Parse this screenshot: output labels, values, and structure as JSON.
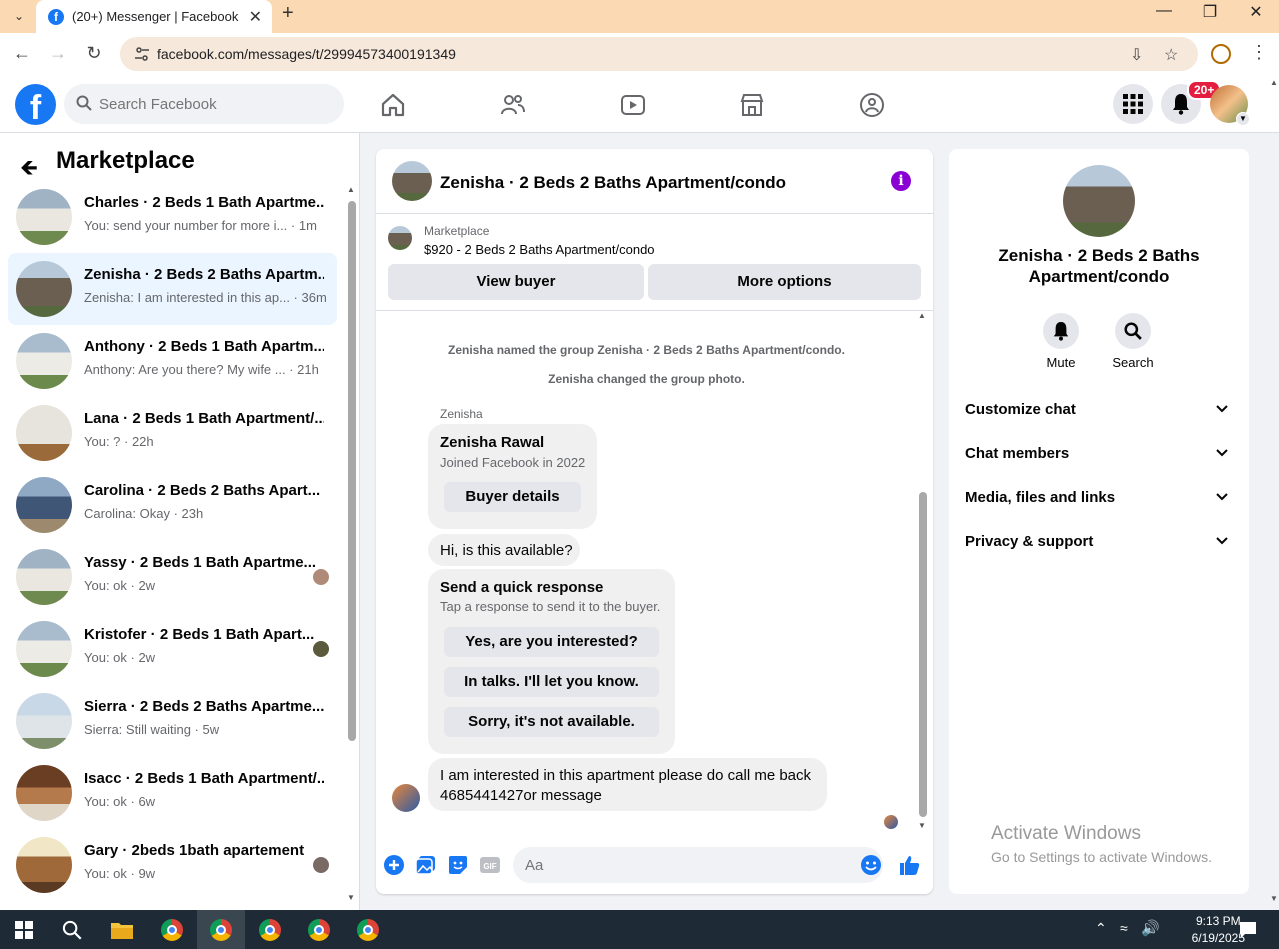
{
  "browser": {
    "tab_title": "(20+) Messenger | Facebook",
    "url": "facebook.com/messages/t/29994573400191349"
  },
  "header": {
    "search_placeholder": "Search Facebook",
    "notification_badge": "20+"
  },
  "sidebar": {
    "title": "Marketplace",
    "conversations": [
      {
        "name": "Charles · 2 Beds 1 Bath Apartme...",
        "preview": "You: send your number for more i... · 1m",
        "active": false
      },
      {
        "name": "Zenisha · 2 Beds 2 Baths Apartm...",
        "preview": "Zenisha: I am interested in this ap... · 36m",
        "active": true
      },
      {
        "name": "Anthony · 2 Beds 1 Bath Apartm...",
        "preview": "Anthony: Are you there? My wife ... · 21h",
        "active": false
      },
      {
        "name": "Lana · 2 Beds 1 Bath Apartment/...",
        "preview": "You: ? · 22h",
        "active": false
      },
      {
        "name": "Carolina · 2 Beds 2 Baths Apart...",
        "preview": "Carolina: Okay · 23h",
        "active": false
      },
      {
        "name": "Yassy · 2 Beds 1 Bath Apartme...",
        "preview": "You: ok · 2w",
        "active": false
      },
      {
        "name": "Kristofer · 2 Beds 1 Bath Apart...",
        "preview": "You: ok · 2w",
        "active": false
      },
      {
        "name": "Sierra · 2 Beds 2 Baths Apartme...",
        "preview": "Sierra: Still waiting · 5w",
        "active": false
      },
      {
        "name": "Isacc · 2 Beds 1 Bath Apartment/...",
        "preview": "You: ok · 6w",
        "active": false
      },
      {
        "name": "Gary · 2beds 1bath apartement",
        "preview": "You: ok · 9w",
        "active": false
      }
    ]
  },
  "chat": {
    "title": "Zenisha · 2 Beds 2 Baths Apartment/condo",
    "listing_source": "Marketplace",
    "listing_price": "$920 - 2 Beds 2 Baths Apartment/condo",
    "view_buyer": "View buyer",
    "more_options": "More options",
    "system_1": "Zenisha named the group Zenisha · 2 Beds 2 Baths Apartment/condo.",
    "system_2": "Zenisha changed the group photo.",
    "sender_label": "Zenisha",
    "profile_name": "Zenisha Rawal",
    "profile_joined": "Joined Facebook in 2022",
    "buyer_details": "Buyer details",
    "msg_available": "Hi, is this available?",
    "quick_title": "Send a quick response",
    "quick_sub": "Tap a response to send it to the buyer.",
    "quick_1": "Yes, are you interested?",
    "quick_2": "In talks. I'll let you know.",
    "quick_3": "Sorry, it's not available.",
    "msg_last_1": "I am interested in this apartment please do call me back",
    "msg_last_2": "4685441427or message",
    "composer_placeholder": "Aa"
  },
  "right_panel": {
    "name_line1": "Zenisha · 2 Beds 2 Baths",
    "name_line2": "Apartment/condo",
    "mute": "Mute",
    "search": "Search",
    "sections": [
      "Customize chat",
      "Chat members",
      "Media, files and links",
      "Privacy & support"
    ]
  },
  "watermark": {
    "line1": "Activate Windows",
    "line2": "Go to Settings to activate Windows."
  },
  "taskbar": {
    "time": "9:13 PM",
    "date": "6/19/2025"
  },
  "colors": {
    "fb_blue": "#1877f2",
    "active_conv": "#ebf5ff",
    "info_purple": "#8a00d4",
    "badge_red": "#e41e3f"
  }
}
